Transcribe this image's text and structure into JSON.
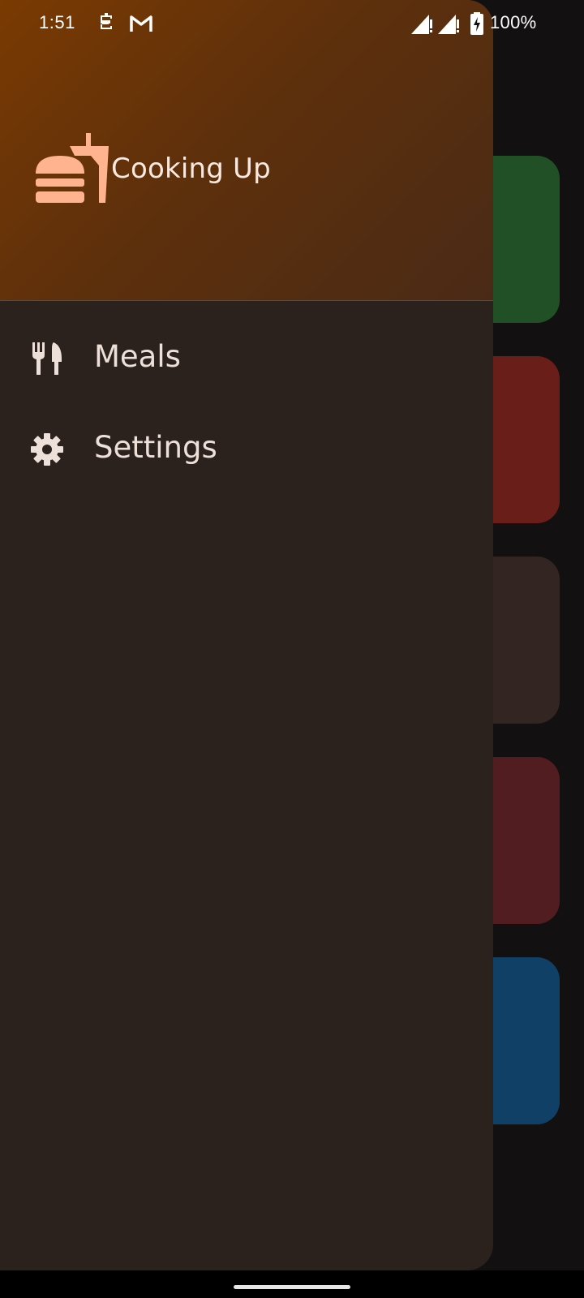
{
  "status_bar": {
    "time": "1:51",
    "battery_text": "100%",
    "icons": [
      "sim-toolkit-icon",
      "gmail-icon",
      "signal-icon",
      "signal-icon",
      "battery-charging-icon"
    ]
  },
  "drawer": {
    "app_title": "Cooking Up",
    "logo_icon": "fastfood-icon",
    "items": [
      {
        "label": "Meals",
        "icon": "restaurant-icon"
      },
      {
        "label": "Settings",
        "icon": "gear-icon"
      }
    ]
  },
  "background": {
    "card_colors": [
      "#225026",
      "#6a1e1a",
      "#332521",
      "#521d20",
      "#114066"
    ]
  },
  "colors": {
    "header_gradient_start": "#7a3a02",
    "header_gradient_end": "#4a2a16",
    "drawer_bg": "#2b221e",
    "accent_peach": "#ffb38e",
    "label_text": "#ede0d8"
  }
}
